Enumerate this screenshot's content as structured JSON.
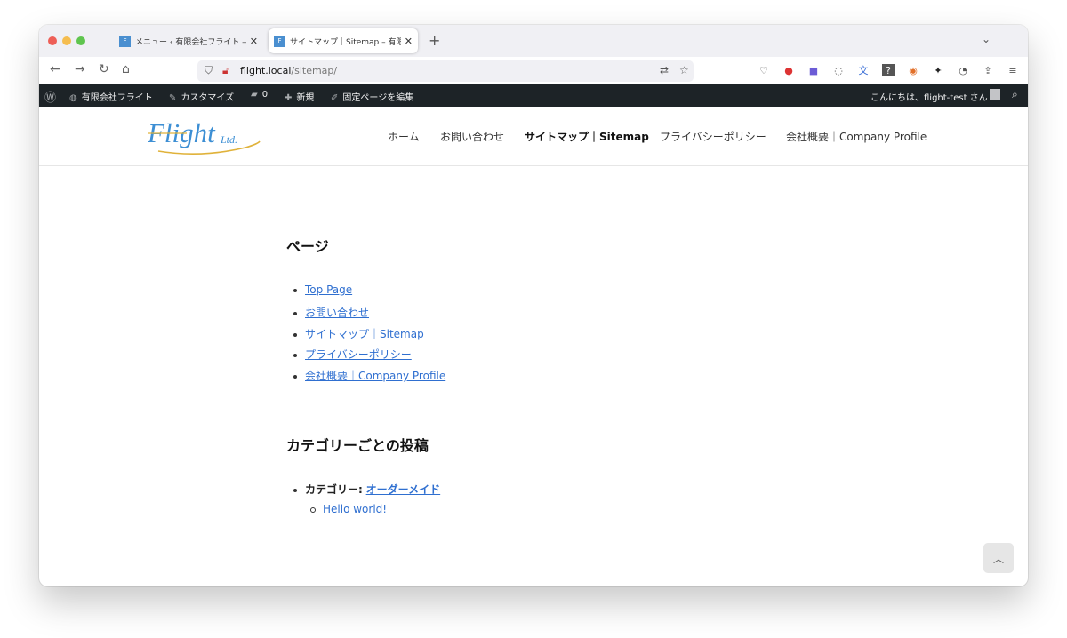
{
  "browser": {
    "tabs": [
      {
        "title": "メニュー ‹ 有限会社フライト — W",
        "favicon": "flight-favicon",
        "active": false
      },
      {
        "title": "サイトマップ｜Sitemap – 有限会",
        "favicon": "flight-favicon",
        "active": true
      }
    ],
    "url_host": "flight.local",
    "url_path": "/sitemap/"
  },
  "adminbar": {
    "site_name": "有限会社フライト",
    "customize": "カスタマイズ",
    "comments_count": "0",
    "new_label": "新規",
    "edit_label": "固定ページを編集",
    "greeting": "こんにちは、flight-test さん"
  },
  "site": {
    "logo_text": "Flight",
    "logo_suffix": "Ltd.",
    "menu": [
      {
        "label": "ホーム",
        "current": false
      },
      {
        "label": "お問い合わせ",
        "current": false
      },
      {
        "label": "サイトマップ｜Sitemap",
        "current": true
      },
      {
        "label": "プライバシーポリシー",
        "current": false
      },
      {
        "label": "会社概要｜Company Profile",
        "current": false
      }
    ]
  },
  "content": {
    "pages_heading": "ページ",
    "pages": [
      "Top Page",
      "お問い合わせ",
      "サイトマップ｜Sitemap",
      "プライバシーポリシー",
      "会社概要｜Company Profile"
    ],
    "category_heading": "カテゴリーごとの投稿",
    "category_prefix": "カテゴリー:",
    "category_name": "オーダーメイド",
    "posts": [
      "Hello world!"
    ]
  },
  "colors": {
    "link": "#2f6fd0",
    "adminbar": "#1d2327",
    "logo_blue": "#3d8fd4",
    "logo_gold": "#e0b23a"
  }
}
